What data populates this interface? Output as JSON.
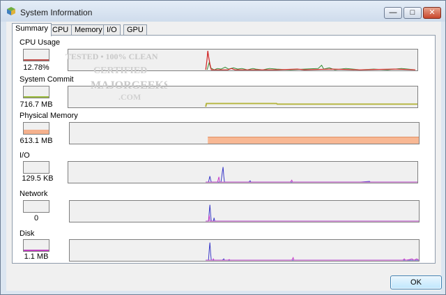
{
  "window": {
    "title": "System Information",
    "minimize_glyph": "—",
    "maximize_glyph": "□",
    "close_glyph": "✕"
  },
  "tabs": [
    {
      "label": "Summary",
      "active": true
    },
    {
      "label": "CPU",
      "active": false
    },
    {
      "label": "Memory",
      "active": false
    },
    {
      "label": "I/O",
      "active": false
    },
    {
      "label": "GPU",
      "active": false
    }
  ],
  "metrics": {
    "cpu": {
      "label": "CPU Usage",
      "value": "12.78%",
      "color": "#c0504d",
      "level": 0.13
    },
    "commit": {
      "label": "System Commit",
      "value": "716.7 MB",
      "color": "#9bbb3b",
      "level": 0.15
    },
    "memory": {
      "label": "Physical Memory",
      "value": "613.1 MB",
      "color": "#f5b18d",
      "level": 0.35
    },
    "io": {
      "label": "I/O",
      "value": "129.5  KB",
      "color": "#5d5dd8",
      "level": 0.0
    },
    "network": {
      "label": "Network",
      "value": "0",
      "color": "#5d5dd8",
      "level": 0.0
    },
    "disk": {
      "label": "Disk",
      "value": "1.1  MB",
      "color": "#c03ec0",
      "level": 0.1
    }
  },
  "watermark": {
    "lines": [
      "TESTED • 100% CLEAN",
      "CERTIFIED",
      "MAJORGEEKS",
      ".COM"
    ]
  },
  "ok_label": "OK",
  "colors": {
    "graph_bg": "#f0f0f0",
    "cpu_kernel": "#d01f1f",
    "cpu_user": "#2e8b2e",
    "commit_line": "#b4b43c",
    "memory_fill": "#f8b894",
    "io_read": "#3a3ac8",
    "io_write": "#c83cc8"
  }
}
